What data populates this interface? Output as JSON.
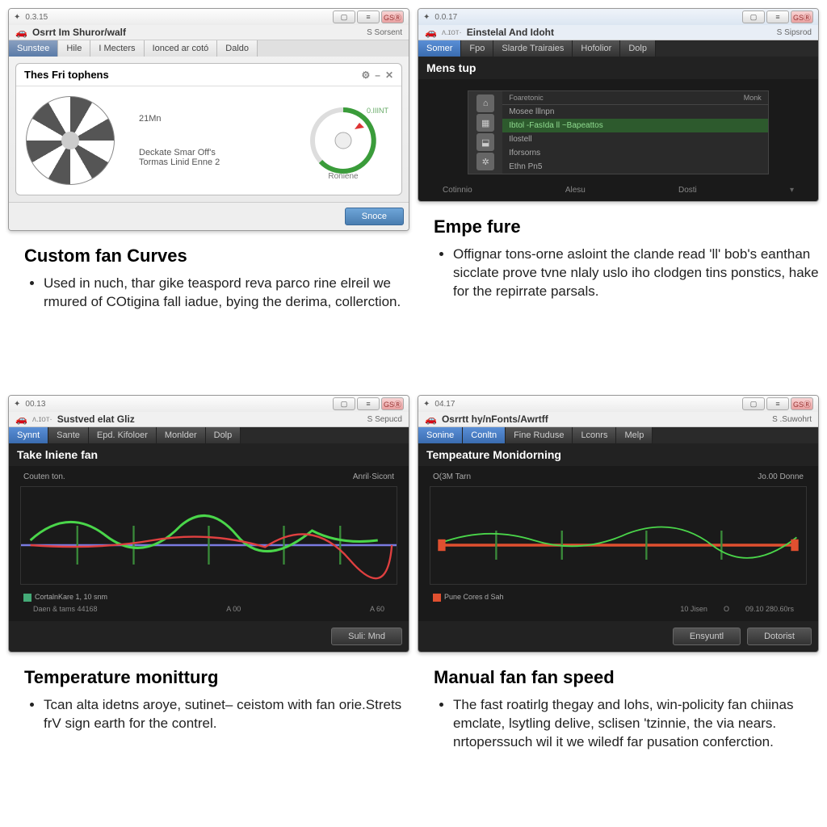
{
  "p1": {
    "ver": "0.3.15",
    "title": "Osrrt Im Shuror/walf",
    "rbtn": "S Sorsent",
    "tabs": [
      "Sunstee",
      "Hile",
      "I Mecters",
      "Ionced ar cotó",
      "Daldo"
    ],
    "panel_title": "Thes Fri tophens",
    "rpm": "21Mn",
    "desc1": "Deckate Smar Off's",
    "desc2": "Tormas Linid Enne 2",
    "gauge_lbl": "0.IIINT",
    "gauge_bot": "Roniene",
    "btn": "Snoce"
  },
  "p2": {
    "ver": "0.0.17",
    "title": "Einstelal And Idoht",
    "rbtn": "S Sipsrod",
    "tabs": [
      "Somer",
      "Fpo",
      "Slarde Trairaies",
      "Hofolior",
      "Dolp"
    ],
    "panel_title": "Mens tup",
    "hdr1": "Foaretonic",
    "hdr2": "Monk",
    "r1": "Mosee lllnpn",
    "r2": "Ibtol -FasIda ll ~Bapeattos",
    "r3": "Ilostell",
    "r4": "Iforsorns",
    "r5": "Ethn Pn5",
    "b1": "Cotinnio",
    "b2": "Alesu",
    "b3": "Dosti"
  },
  "p3": {
    "ver": "00.13",
    "title": "Sustved elat Gliz",
    "rbtn": "S Sepucd",
    "tabs": [
      "Synnt",
      "Sante",
      "Epd. Kifoloer",
      "Monlder",
      "Dolp"
    ],
    "panel_title": "Take lniene fan",
    "ylabel": "Couten ton.",
    "rlabel": "Anril·Sicont",
    "leg": "CortalnKare 1, 10 snm",
    "x1": "Daen & tams   44168",
    "x2": "A 00",
    "x3": "A 60",
    "btn": "Suli: Mnd"
  },
  "p4": {
    "ver": "04.17",
    "title": "Osrrtt hy/nFonts/Awrtff",
    "rbtn": "S .Suwohrt",
    "tabs": [
      "Sonine",
      "Conltn",
      "Fine Ruduse",
      "Lconrs",
      "Melp"
    ],
    "panel_title": "Tempeature Monidorning",
    "ylabel": "O(3M Tarn",
    "rlabel": "Jo.00 Donne",
    "leg": "Pune Cores  d  Sah",
    "x1": "10 Jisen",
    "x2": "O",
    "x3": "09.10  280.60rs",
    "btn1": "Ensyuntl",
    "btn2": "Dotorist"
  },
  "text": {
    "h1": "Custom fan Curves",
    "b1": "Used in nuch, thar gike teaspord reva parco rine elreil we rmured of COtigina fall iadue, bying the derima, collerction.",
    "h2": "Empe fure",
    "b2": "Offignar tons-orne asloint the clande read 'll' bob's eanthan sicclate prove tvne nlaly uslo iho clodgen tins ponstics, hake for the repirrate parsals.",
    "h3": "Temperature monitturg",
    "b3": "Tcan alta idetns aroye, sutinet– ceistom with fan orie.Strets frV sign earth for the contrel.",
    "h4": "Manual fan fan speed",
    "b4": "The fast roatirlg thegay and lohs, win-policity fan chiinas emclate, lsytling delive, sclisen 'tzinnie, the via nears. nrtoperssuch wil it we wiledf far pusation conferction."
  }
}
